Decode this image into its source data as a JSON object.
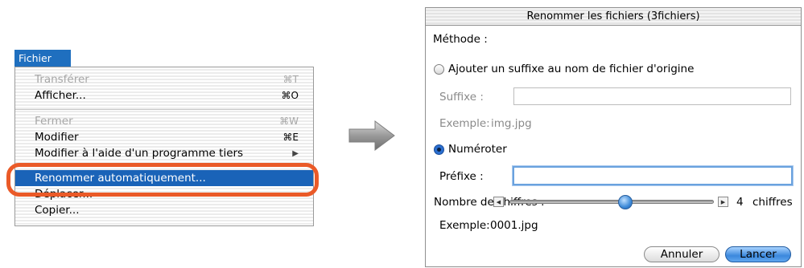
{
  "menu": {
    "title": "Fichier",
    "items": [
      {
        "label": "Transférer",
        "shortcut": "⌘T"
      },
      {
        "label": "Afficher...",
        "shortcut": "⌘O"
      },
      {
        "label": "Fermer",
        "shortcut": "⌘W"
      },
      {
        "label": "Modifier",
        "shortcut": "⌘E"
      },
      {
        "label": "Modifier à l'aide d'un programme tiers",
        "shortcut": "▶"
      },
      {
        "label": "Renommer automatiquement..."
      },
      {
        "label": "Déplacer..."
      },
      {
        "label": "Copier..."
      }
    ]
  },
  "dialog": {
    "title": "Renommer les fichiers (3fichiers)",
    "method_label": "Méthode :",
    "option_suffix": "Ajouter un suffixe au nom de fichier d'origine",
    "suffix_label": "Suffixe :",
    "suffix_value": "",
    "suffix_example_label": "Exemple:",
    "suffix_example_value": "img.jpg",
    "option_number": "Numéroter",
    "prefix_label": "Préfixe :",
    "prefix_value": "",
    "digits_label": "Nombre de chiffres :",
    "digits_value": "4",
    "digits_unit": "chiffres",
    "number_example_label": "Exemple:",
    "number_example_value": "0001.jpg",
    "cancel_label": "Annuler",
    "run_label": "Lancer"
  },
  "colors": {
    "menu_highlight": "#1a63b8",
    "callout_ring": "#ea5a28",
    "default_button": "#3b88dd"
  },
  "icons": {
    "flow_arrow": "right-arrow-icon",
    "submenu_arrow": "triangle-right-icon"
  }
}
